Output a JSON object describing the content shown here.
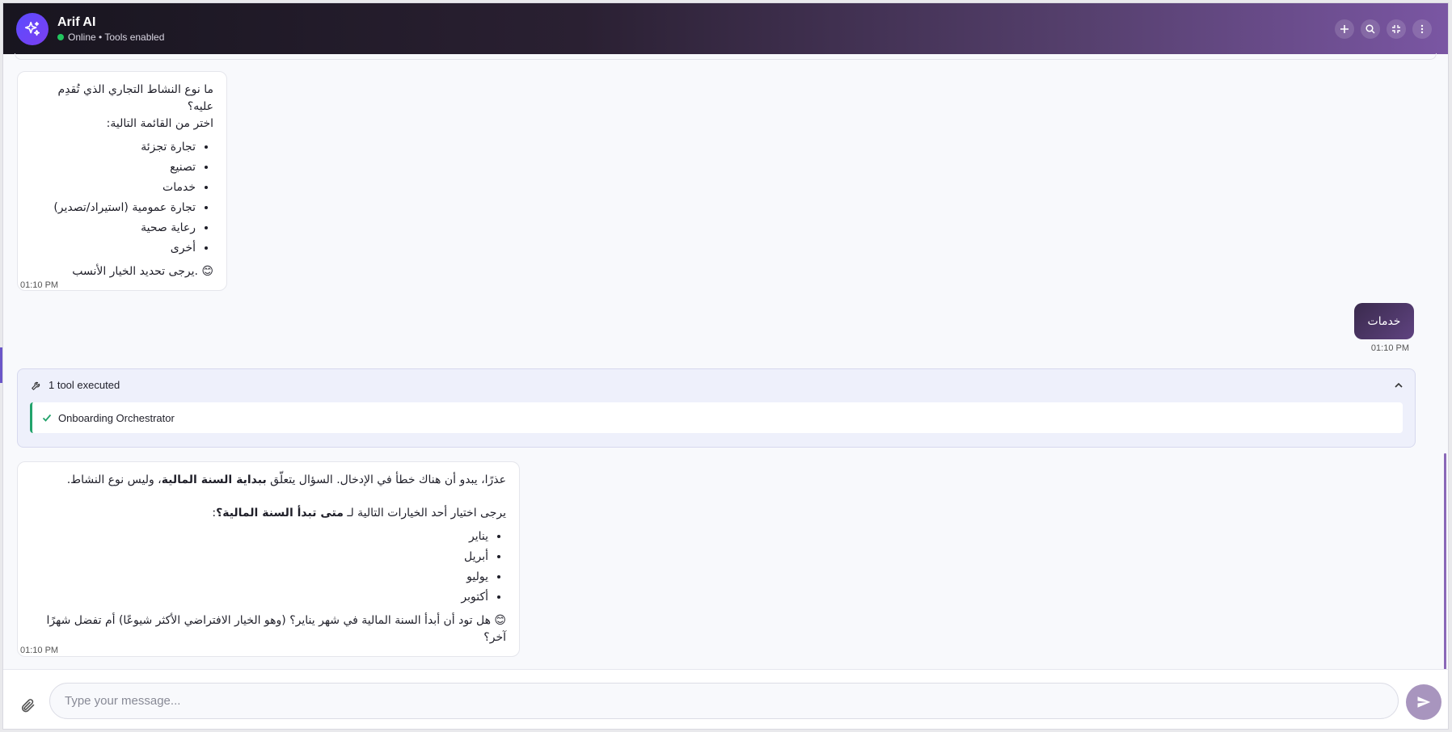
{
  "header": {
    "title": "Arif AI",
    "status": "Online • Tools enabled"
  },
  "messages": {
    "first": {
      "question": "ما نوع النشاط التجاري الذي تُقدِم عليه؟",
      "instruction": "اختر من القائمة التالية:",
      "options": [
        "تجارة تجزئة",
        "تصنيع",
        "خدمات",
        "تجارة عمومية (استيراد/تصدير)",
        "رعاية صحية",
        "أخرى"
      ],
      "closing": "😊 .يرجى تحديد الخيار الأنسب",
      "time": "01:10 PM"
    },
    "user": {
      "text": "خدمات",
      "time": "01:10 PM"
    },
    "tools": {
      "summary": "1 tool executed",
      "items": [
        "Onboarding Orchestrator"
      ]
    },
    "second": {
      "line1_a": "عذرًا، يبدو أن هناك خطأ في الإدخال. السؤال يتعلّق ",
      "line1_bold": "ببداية السنة المالية",
      "line1_b": "، وليس نوع النشاط.",
      "line2_a": "يرجى اختيار أحد الخيارات التالية لـ ",
      "line2_bold": "متى تبدأ السنة المالية؟",
      "line2_b": ":",
      "options": [
        "يناير",
        "أبريل",
        "يوليو",
        "أكتوبر"
      ],
      "closing": "😊 هل تود أن أبدأ السنة المالية في شهر يناير؟ (وهو الخيار الافتراضي الأكثر شيوعًا) أم تفضل شهرًا آخر؟",
      "time": "01:10 PM"
    }
  },
  "composer": {
    "placeholder": "Type your message..."
  },
  "icons": {
    "logo": "sparkles-icon",
    "new": "plus-icon",
    "search": "search-icon",
    "minimize": "minimize-icon",
    "menu": "more-vertical-icon",
    "tool": "wrench-icon",
    "check": "check-icon",
    "collapse": "chevron-up-icon",
    "attach": "paperclip-icon",
    "send": "send-icon"
  },
  "colors": {
    "accent": "#7b3ff0",
    "online": "#22c55e",
    "tool_success": "#22a36b"
  }
}
